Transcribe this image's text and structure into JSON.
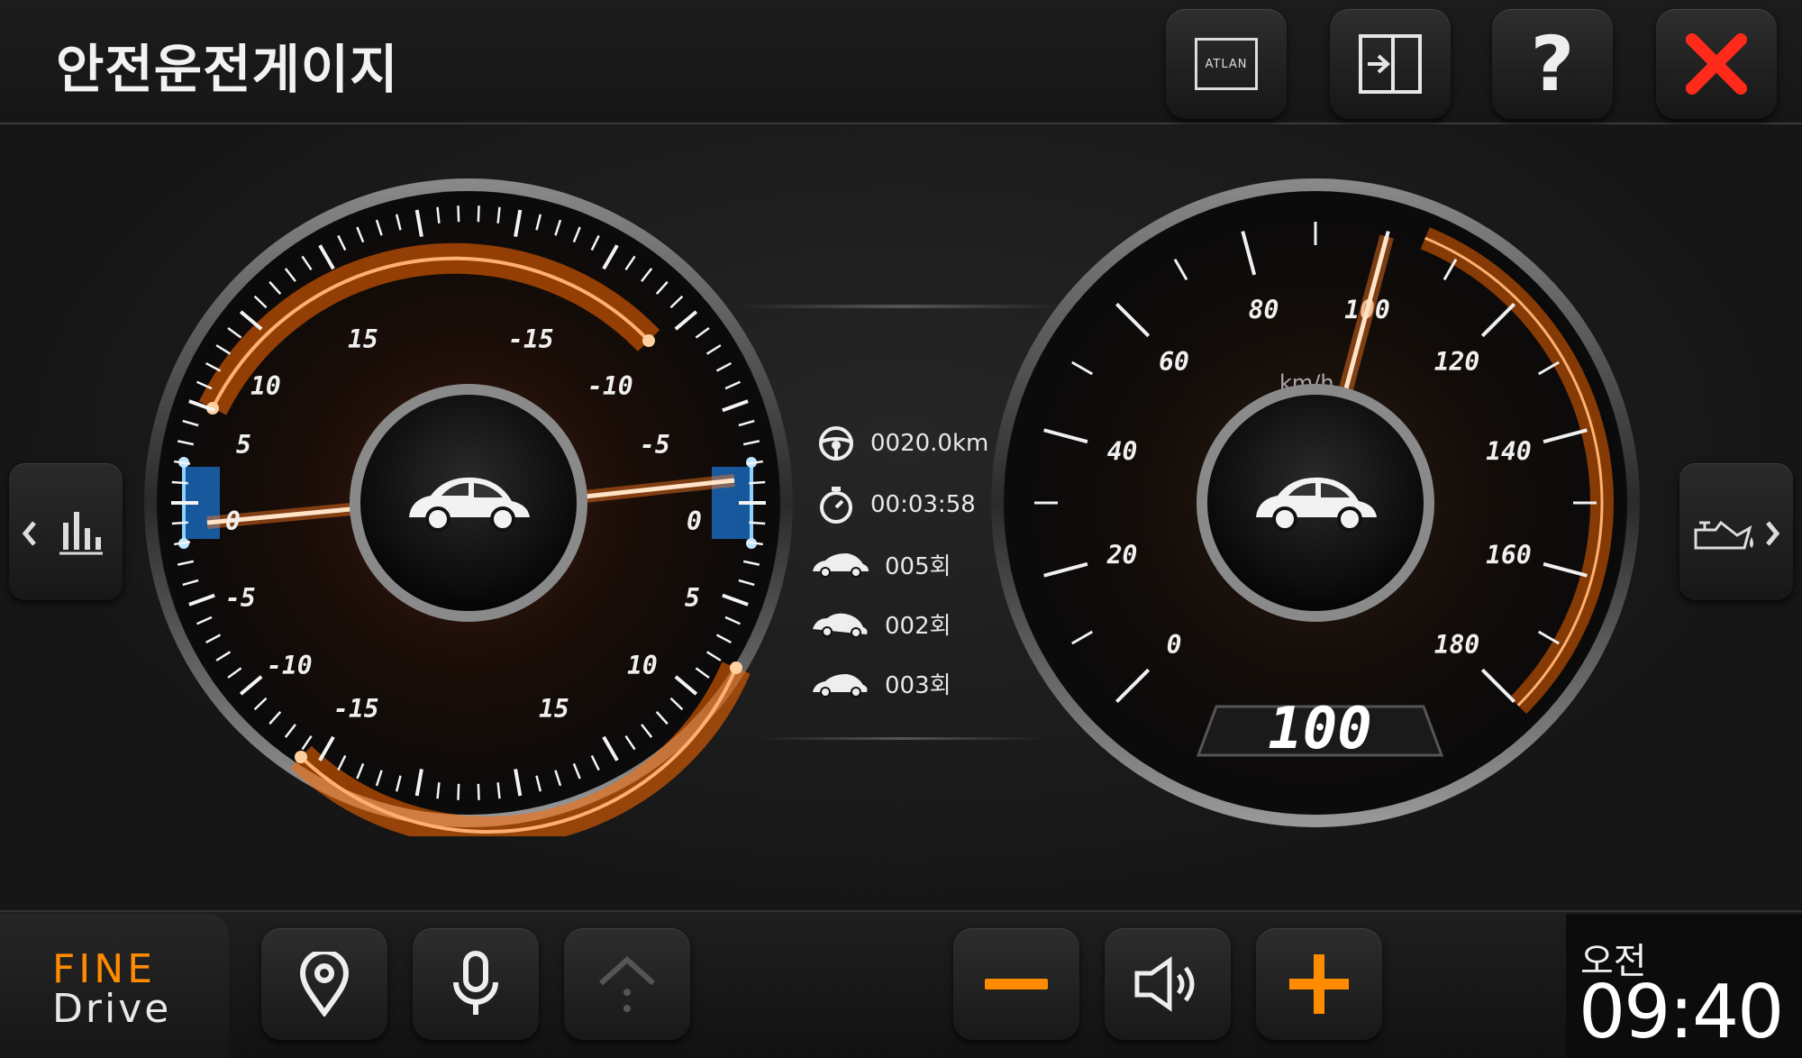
{
  "header": {
    "title": "안전운전게이지",
    "atlan_label": "ATLAN"
  },
  "tilt_gauge": {
    "top_labels": [
      "15",
      "-15"
    ],
    "left_labels": [
      "10",
      "5",
      "0",
      "-5",
      "-10"
    ],
    "right_labels": [
      "-10",
      "-5",
      "0",
      "5",
      "10"
    ],
    "bottom_labels": [
      "-15",
      "15"
    ]
  },
  "trip_info": {
    "distance": "0020.0km",
    "time": "00:03:58",
    "event1": "005회",
    "event2": "002회",
    "event3": "003회"
  },
  "speedometer": {
    "unit": "km/h",
    "tick_labels": [
      "0",
      "20",
      "40",
      "60",
      "80",
      "100",
      "120",
      "140",
      "160",
      "180"
    ],
    "speed_value": 100,
    "speed_display": "100"
  },
  "footer": {
    "logo_line1": "FINE",
    "logo_line2": "Drive",
    "ampm": "오전",
    "time": "09:40"
  },
  "colors": {
    "accent_orange": "#ff6a00",
    "close_red": "#ff2a1a",
    "tilt_blue": "#1e8cff",
    "footer_orange": "#ff8c00"
  }
}
